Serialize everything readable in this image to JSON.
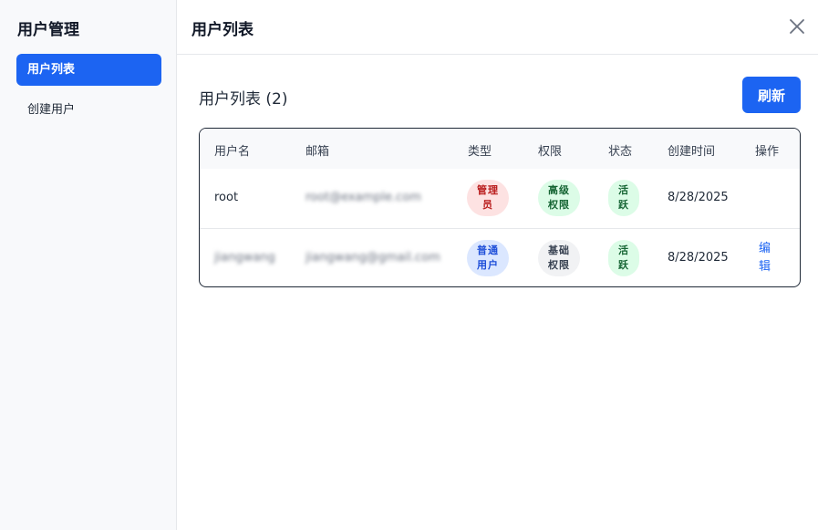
{
  "sidebar": {
    "title": "用户管理",
    "items": [
      {
        "label": "用户列表",
        "active": true
      },
      {
        "label": "创建用户",
        "active": false
      }
    ]
  },
  "header": {
    "title": "用户列表",
    "close_icon": "close-icon"
  },
  "main": {
    "section_title": "用户列表 (2)",
    "refresh_label": "刷新"
  },
  "table": {
    "columns": [
      "用户名",
      "邮箱",
      "类型",
      "权限",
      "状态",
      "创建时间",
      "操作"
    ],
    "rows": [
      {
        "username": "root",
        "email": "root@example.com",
        "type": "管理员",
        "permission": "高级权限",
        "status": "活跃",
        "created": "8/28/2025",
        "action": ""
      },
      {
        "username": "jiangwang",
        "email": "jiangwang@gmail.com",
        "type": "普通用户",
        "permission": "基础权限",
        "status": "活跃",
        "created": "8/28/2025",
        "action": "编辑"
      }
    ]
  },
  "colors": {
    "accent": "#1c64f2",
    "admin_badge": "#fde2e2",
    "user_badge": "#dbe7ff",
    "success_badge": "#dcfce7"
  }
}
